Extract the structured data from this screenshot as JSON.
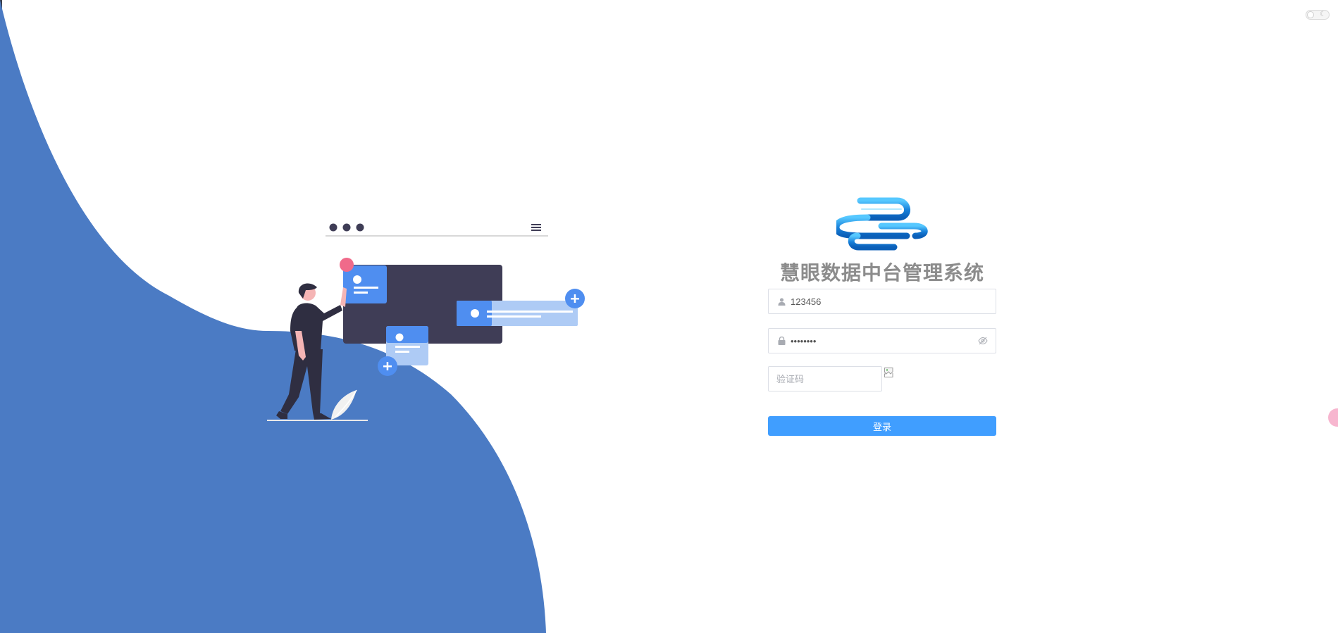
{
  "app": {
    "title": "慧眼数据中台管理系统"
  },
  "login_form": {
    "username_value": "123456",
    "password_value": "••••••••",
    "captcha_placeholder": "验证码",
    "submit_label": "登录"
  },
  "icons": {
    "username": "user-icon",
    "password": "lock-icon",
    "password_toggle": "eye-slash-icon",
    "theme_toggle": "moon-icon",
    "captcha": "broken-image-icon"
  },
  "colors": {
    "wave": "#4b7bc4",
    "primary_button": "#409eff",
    "title": "#8c8c8c",
    "illustration_dark": "#3f3d56",
    "illustration_accent": "#f06a8a",
    "illustration_card": "#4f8ef0"
  }
}
